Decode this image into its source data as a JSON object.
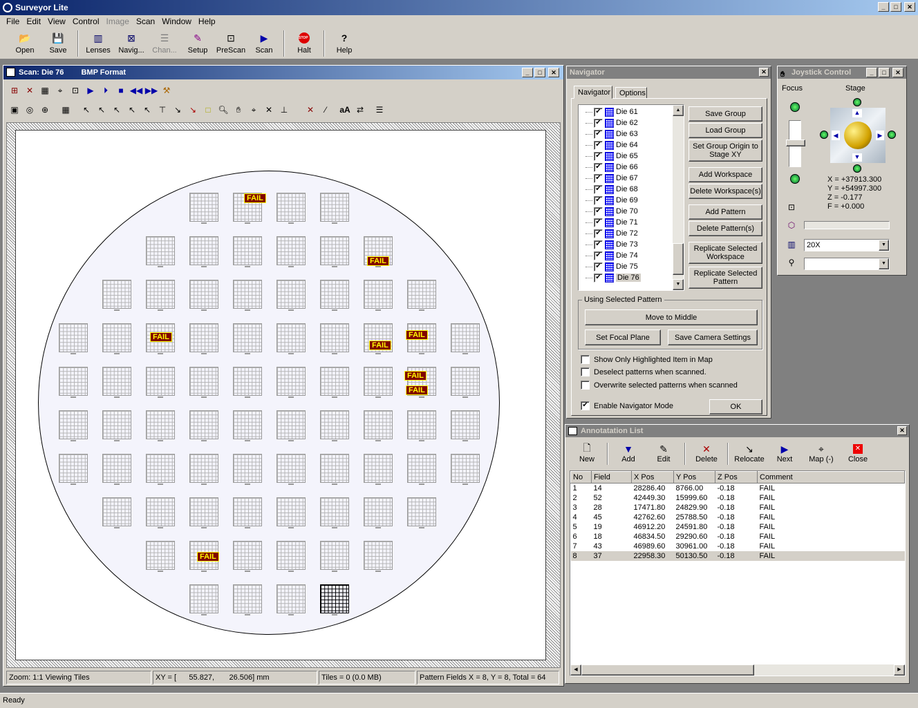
{
  "app": {
    "title": "Surveyor Lite"
  },
  "menu": {
    "items": [
      "File",
      "Edit",
      "View",
      "Control",
      "Image",
      "Scan",
      "Window",
      "Help"
    ]
  },
  "toolbar": {
    "open": "Open",
    "save": "Save",
    "lenses": "Lenses",
    "navig": "Navig...",
    "chan": "Chan...",
    "setup": "Setup",
    "prescan": "PreScan",
    "scan": "Scan",
    "halt": "Halt",
    "help": "Help"
  },
  "scan_window": {
    "title": "Scan:  Die 76",
    "format": "BMP Format",
    "fail_label": "FAIL",
    "status": {
      "zoom": "Zoom: 1:1 Viewing Tiles",
      "xy": "XY = [      55.827,       26.506] mm",
      "tiles": "Tiles = 0 (0.0 MB)",
      "pattern": "Pattern Fields X = 8, Y = 8, Total = 64"
    }
  },
  "navigator": {
    "title": "Navigator",
    "tabs": [
      "Navigator",
      "Options"
    ],
    "dies": [
      "Die 61",
      "Die 62",
      "Die 63",
      "Die 64",
      "Die 65",
      "Die 66",
      "Die 67",
      "Die 68",
      "Die 69",
      "Die 70",
      "Die 71",
      "Die 72",
      "Die 73",
      "Die 74",
      "Die 75",
      "Die 76"
    ],
    "buttons": {
      "save_group": "Save Group",
      "load_group": "Load Group",
      "set_origin": "Set Group Origin to Stage XY",
      "add_workspace": "Add Workspace",
      "delete_workspace": "Delete Workspace(s)",
      "add_pattern": "Add Pattern",
      "delete_pattern": "Delete Pattern(s)",
      "replicate_workspace": "Replicate Selected Workspace",
      "replicate_pattern": "Replicate Selected Pattern",
      "move_middle": "Move to Middle",
      "set_focal": "Set Focal Plane",
      "save_camera": "Save Camera Settings",
      "ok": "OK"
    },
    "group_label": "Using Selected Pattern",
    "options": {
      "show_highlighted": "Show Only Highlighted Item in Map",
      "deselect": "Deselect patterns when scanned.",
      "overwrite": "Overwrite selected patterns when scanned",
      "enable_nav": "Enable Navigator Mode"
    }
  },
  "joystick": {
    "title": "Joystick Control",
    "focus_label": "Focus",
    "stage_label": "Stage",
    "x": "X = +37913.300",
    "y": "Y = +54997.300",
    "z": "Z = -0.177",
    "f": "F = +0.000",
    "lens": "20X",
    "second": ""
  },
  "annotation": {
    "title": "Annotatation List",
    "toolbar": {
      "new": "New",
      "add": "Add",
      "edit": "Edit",
      "delete": "Delete",
      "relocate": "Relocate",
      "next": "Next",
      "map": "Map (-)",
      "close": "Close"
    },
    "columns": [
      "No",
      "Field",
      "X Pos",
      "Y Pos",
      "Z Pos",
      "Comment"
    ],
    "rows": [
      [
        "1",
        "14",
        "28286.40",
        "8766.00",
        "-0.18",
        "FAIL"
      ],
      [
        "2",
        "52",
        "42449.30",
        "15999.60",
        "-0.18",
        "FAIL"
      ],
      [
        "3",
        "28",
        "17471.80",
        "24829.90",
        "-0.18",
        "FAIL"
      ],
      [
        "4",
        "45",
        "42762.60",
        "25788.50",
        "-0.18",
        "FAIL"
      ],
      [
        "5",
        "19",
        "46912.20",
        "24591.80",
        "-0.18",
        "FAIL"
      ],
      [
        "6",
        "18",
        "46834.50",
        "29290.60",
        "-0.18",
        "FAIL"
      ],
      [
        "7",
        "43",
        "46989.60",
        "30961.00",
        "-0.18",
        "FAIL"
      ],
      [
        "8",
        "37",
        "22958.30",
        "50130.50",
        "-0.18",
        "FAIL"
      ]
    ],
    "selected_row": 8
  },
  "status": {
    "text": "Ready"
  }
}
